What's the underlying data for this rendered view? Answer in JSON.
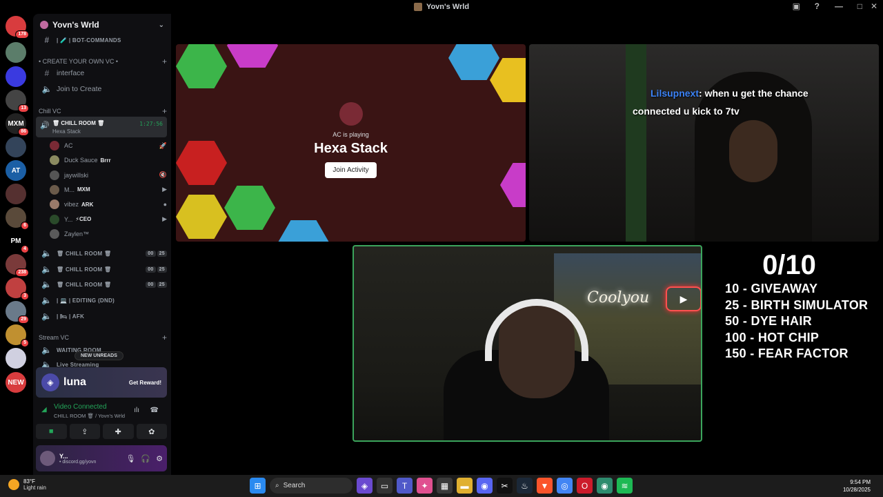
{
  "window": {
    "title": "Yovn's Wrld"
  },
  "rail": {
    "servers": [
      {
        "name": "discord-home-icon",
        "color": "#d83c3e",
        "badge": "178",
        "label": ""
      },
      {
        "name": "server-1",
        "color": "#5b7d6a",
        "badge": "",
        "label": ""
      },
      {
        "name": "server-2",
        "color": "#3a3ae0",
        "badge": "",
        "label": ""
      },
      {
        "name": "server-3",
        "color": "#444",
        "badge": "13",
        "label": ""
      },
      {
        "name": "server-mxm",
        "color": "#222",
        "badge": "86",
        "label": "MXM"
      },
      {
        "name": "server-5",
        "color": "#33445a",
        "badge": "",
        "label": ""
      },
      {
        "name": "server-6",
        "color": "#1b5fa5",
        "badge": "",
        "label": "AT"
      },
      {
        "name": "server-7",
        "color": "#553030",
        "badge": "",
        "label": ""
      },
      {
        "name": "server-8",
        "color": "#5a4a3a",
        "badge": "6",
        "label": ""
      },
      {
        "name": "server-pm",
        "color": "#000",
        "badge": "4",
        "label": "PM"
      },
      {
        "name": "server-10",
        "color": "#7a3a3a",
        "badge": "238",
        "label": ""
      },
      {
        "name": "server-11",
        "color": "#c04040",
        "badge": "3",
        "label": ""
      },
      {
        "name": "server-12",
        "color": "#6a7a8a",
        "badge": "29",
        "label": ""
      },
      {
        "name": "server-13",
        "color": "#c09030",
        "badge": "5",
        "label": ""
      },
      {
        "name": "server-14",
        "color": "#d0d0e0",
        "badge": "",
        "label": ""
      },
      {
        "name": "server-new",
        "color": "#d83c3e",
        "badge": "",
        "label": "NEW"
      }
    ]
  },
  "sidebar": {
    "server_name": "Yovn's Wrld",
    "channels_top": [
      {
        "icon": "#",
        "label": "| 🧪 | BOT-COMMANDS",
        "small": true
      }
    ],
    "category_create": "• CREATE YOUR OWN VC •",
    "create_channels": [
      {
        "icon": "#",
        "label": "interface"
      },
      {
        "icon": "🔊",
        "label": "Join to Create"
      }
    ],
    "category_chill": "Chill VC",
    "active_room": {
      "name": "🗑 CHILL ROOM 🗑",
      "sub": "Hexa Stack",
      "timer": "1:27:56"
    },
    "members": [
      {
        "name": "AC",
        "tag": "",
        "color": "#7a2a35",
        "right": "🚀"
      },
      {
        "name": "Duck Sauce",
        "tag": "Brrr",
        "color": "#8a8a60",
        "right": ""
      },
      {
        "name": "jaywillski",
        "tag": "",
        "color": "#555",
        "right": "🔇"
      },
      {
        "name": "M...",
        "tag": "MXM",
        "color": "#6a5a4a",
        "right": "▶"
      },
      {
        "name": "vibez",
        "tag": "ARK",
        "color": "#9a7a6a",
        "right": "●"
      },
      {
        "name": "Y...",
        "tag": "⚡CEO",
        "color": "#2a4a2a",
        "right": "▶"
      },
      {
        "name": "Zaylen™",
        "tag": "",
        "color": "#5a5a5a",
        "right": ""
      }
    ],
    "voice_rooms": [
      {
        "label": "🗑 CHILL ROOM 🗑",
        "a": "00",
        "b": "25"
      },
      {
        "label": "🗑 CHILL ROOM 🗑",
        "a": "00",
        "b": "25"
      },
      {
        "label": "🗑 CHILL ROOM 🗑",
        "a": "00",
        "b": "25"
      },
      {
        "label": "| 💻 | EDITING (DND)",
        "a": "",
        "b": ""
      },
      {
        "label": "| 🛏 | AFK",
        "a": "",
        "b": ""
      }
    ],
    "category_stream": "Stream VC",
    "stream_channels": [
      {
        "label": "WAITING ROOM"
      },
      {
        "label": "Live Streaming"
      }
    ],
    "new_unreads": "NEW UNREADS",
    "luna": {
      "brand": "luna",
      "reward": "Get Reward!"
    },
    "voice": {
      "state": "Video Connected",
      "where": "CHILL ROOM 🗑 / Yovn's Wrld"
    },
    "user": {
      "name": "Y...",
      "status": "• discord.gg/yovn"
    }
  },
  "stage": {
    "activity": {
      "host": "AC is playing",
      "game": "Hexa Stack",
      "join": "Join Activity"
    },
    "chat": {
      "user": "Lilsupnext",
      "message": "when u get the chance",
      "line2": "connected u kick to 7tv"
    },
    "neon_sign": "Coolyou"
  },
  "goals": {
    "count": "0/10",
    "items": [
      "10 - GIVEAWAY",
      "25 - BIRTH SIMULATOR",
      "50 - DYE HAIR",
      "100 - HOT CHIP",
      "150 - FEAR FACTOR"
    ]
  },
  "taskbar": {
    "weather_temp": "83°F",
    "weather_cond": "Light rain",
    "search": "Search",
    "time": "9:54 PM",
    "date": "10/28/2025",
    "apps": [
      {
        "name": "windows-start-icon",
        "color": "#2a8af0",
        "glyph": "⊞"
      },
      {
        "name": "copilot-icon",
        "color": "#6a4ad0",
        "glyph": "◈"
      },
      {
        "name": "task-view-icon",
        "color": "#333",
        "glyph": "▭"
      },
      {
        "name": "teams-icon",
        "color": "#5059c9",
        "glyph": "T"
      },
      {
        "name": "copilot-app-icon",
        "color": "#e05090",
        "glyph": "✦"
      },
      {
        "name": "store-icon",
        "color": "#3a3a3a",
        "glyph": "▦"
      },
      {
        "name": "file-explorer-icon",
        "color": "#e0b030",
        "glyph": "▬"
      },
      {
        "name": "discord-icon",
        "color": "#5865f2",
        "glyph": "◉"
      },
      {
        "name": "capcut-icon",
        "color": "#111",
        "glyph": "✂"
      },
      {
        "name": "steam-icon",
        "color": "#1b2838",
        "glyph": "♨"
      },
      {
        "name": "brave-icon",
        "color": "#fb542b",
        "glyph": "▼"
      },
      {
        "name": "chrome-icon",
        "color": "#4285f4",
        "glyph": "◎"
      },
      {
        "name": "opera-icon",
        "color": "#cc1b2b",
        "glyph": "O"
      },
      {
        "name": "obs-icon",
        "color": "#2d8c6e",
        "glyph": "◉"
      },
      {
        "name": "spotify-icon",
        "color": "#1db954",
        "glyph": "≋"
      }
    ]
  }
}
